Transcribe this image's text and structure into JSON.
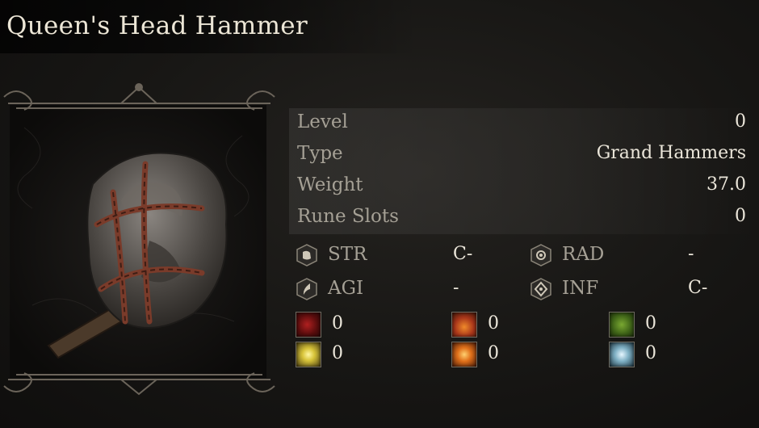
{
  "item": {
    "name": "Queen's Head Hammer"
  },
  "stats": [
    {
      "label": "Level",
      "value": "0"
    },
    {
      "label": "Type",
      "value": "Grand Hammers"
    },
    {
      "label": "Weight",
      "value": "37.0"
    },
    {
      "label": "Rune Slots",
      "value": "0"
    }
  ],
  "attributes": [
    {
      "abbr": "STR",
      "grade": "C-",
      "icon": "strength-icon"
    },
    {
      "abbr": "RAD",
      "grade": "-",
      "icon": "radiance-icon"
    },
    {
      "abbr": "AGI",
      "grade": "-",
      "icon": "agility-icon"
    },
    {
      "abbr": "INF",
      "grade": "C-",
      "icon": "influence-icon"
    }
  ],
  "resistances": [
    {
      "icon": "bleed-icon",
      "value": "0",
      "color": "#8c1b1b"
    },
    {
      "icon": "fire-icon",
      "value": "0",
      "color": "#c2541a"
    },
    {
      "icon": "poison-icon",
      "value": "0",
      "color": "#4f7a1f"
    },
    {
      "icon": "holy-icon",
      "value": "0",
      "color": "#d8c43a"
    },
    {
      "icon": "explosion-icon",
      "value": "0",
      "color": "#d86a1a"
    },
    {
      "icon": "frost-icon",
      "value": "0",
      "color": "#7fb0c4"
    }
  ]
}
